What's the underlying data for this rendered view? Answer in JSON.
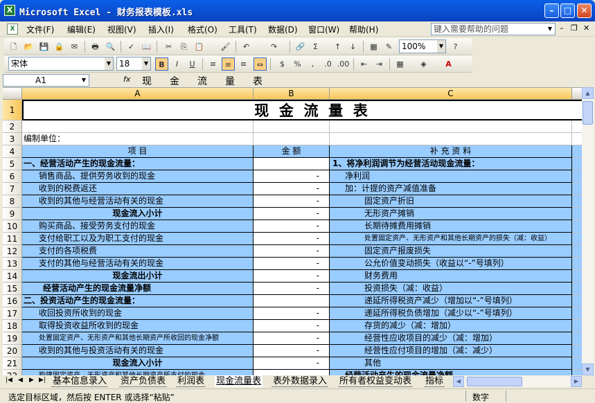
{
  "window": {
    "title": "Microsoft Excel - 财务报表模板.xls",
    "app_icon": "X"
  },
  "menu": {
    "items": [
      "文件(F)",
      "编辑(E)",
      "视图(V)",
      "插入(I)",
      "格式(O)",
      "工具(T)",
      "数据(D)",
      "窗口(W)",
      "帮助(H)"
    ],
    "help_placeholder": "键入需要帮助的问题"
  },
  "toolbar": {
    "zoom": "100%",
    "font": "宋体",
    "size": "18"
  },
  "formula": {
    "cell_ref": "A1",
    "fx": "fx",
    "content": "现金流量表"
  },
  "columns": [
    "A",
    "B",
    "C"
  ],
  "rows": [
    {
      "n": "1",
      "a": "现  金  流  量  表",
      "b": "",
      "c": ""
    },
    {
      "n": "2",
      "a": "",
      "b": "",
      "c": ""
    },
    {
      "n": "3",
      "a": "编制单位：",
      "b": "",
      "c": ""
    },
    {
      "n": "4",
      "a": "项          目",
      "b": "金    额",
      "c": "补  充  资  料"
    },
    {
      "n": "5",
      "a": "一、经营活动产生的现金流量：",
      "b": "",
      "c": "1、将净利润调节为经营活动现金流量："
    },
    {
      "n": "6",
      "a": "销售商品、提供劳务收到的现金",
      "b": "-",
      "c": "净利润"
    },
    {
      "n": "7",
      "a": "收到的税费返还",
      "b": "-",
      "c": "加：计提的资产减值准备"
    },
    {
      "n": "8",
      "a": "收到的其他与经营活动有关的现金",
      "b": "-",
      "c": "固定资产折旧"
    },
    {
      "n": "9",
      "a": "现金流入小计",
      "b": "-",
      "c": "无形资产摊销"
    },
    {
      "n": "10",
      "a": "购买商品、接受劳务支付的现金",
      "b": "-",
      "c": "长期待摊费用摊销"
    },
    {
      "n": "11",
      "a": "支付给职工以及为职工支付的现金",
      "b": "-",
      "c": "处置固定资产、无形资产和其他长期资产的损失（减：收益）"
    },
    {
      "n": "12",
      "a": "支付的各项税费",
      "b": "-",
      "c": "固定资产报废损失"
    },
    {
      "n": "13",
      "a": "支付的其他与经营活动有关的现金",
      "b": "-",
      "c": "公允价值变动损失（收益以“-”号填列）"
    },
    {
      "n": "14",
      "a": "现金流出小计",
      "b": "-",
      "c": "财务费用"
    },
    {
      "n": "15",
      "a": "经营活动产生的现金流量净额",
      "b": "-",
      "c": "投资损失（减：收益）"
    },
    {
      "n": "16",
      "a": "二、投资活动产生的现金流量：",
      "b": "",
      "c": "递延所得税资产减少（增加以“-”号填列）"
    },
    {
      "n": "17",
      "a": "收回投资所收到的现金",
      "b": "-",
      "c": "递延所得税负债增加（减少以“-”号填列）"
    },
    {
      "n": "18",
      "a": "取得投资收益所收到的现金",
      "b": "-",
      "c": "存货的减少（减：增加）"
    },
    {
      "n": "19",
      "a": "处置固定资产、无形资产和其他长期资产所收回的现金净额",
      "b": "-",
      "c": "经营性应收项目的减少（减：增加）"
    },
    {
      "n": "20",
      "a": "收到的其他与投资活动有关的现金",
      "b": "-",
      "c": "经营性应付项目的增加（减：减少）"
    },
    {
      "n": "21",
      "a": "现金流入小计",
      "b": "-",
      "c": "其他"
    },
    {
      "n": "22",
      "a": "购建固定资产、无形资产和其他长期资产所支付的现金",
      "b": "",
      "c": "经营活动产生的现金流量净额"
    }
  ],
  "tabs": [
    "基本信息录入",
    "资产负债表",
    "利润表",
    "现金流量表",
    "表外数据录入",
    "所有者权益变动表",
    "指标"
  ],
  "active_tab": "现金流量表",
  "status": {
    "left": "选定目标区域，然后按 ENTER 或选择“粘贴”",
    "right": "数字"
  },
  "colors": {
    "title_bar": "#0a5fe8",
    "header_blue": "#99ccff"
  }
}
